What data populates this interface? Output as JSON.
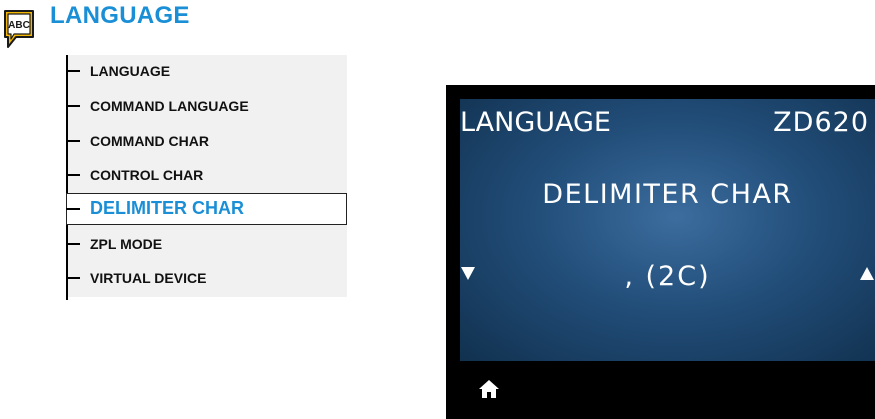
{
  "header": {
    "title": "LANGUAGE",
    "icon": "abc-speech-bubble-icon",
    "icon_text": "ABC",
    "accent_color": "#1a8fd6",
    "icon_color": "#f2b705"
  },
  "menu": {
    "items": [
      {
        "label": "LANGUAGE",
        "selected": false
      },
      {
        "label": "COMMAND LANGUAGE",
        "selected": false
      },
      {
        "label": "COMMAND CHAR",
        "selected": false
      },
      {
        "label": "CONTROL CHAR",
        "selected": false
      },
      {
        "label": "DELIMITER CHAR",
        "selected": true
      },
      {
        "label": "ZPL MODE",
        "selected": false
      },
      {
        "label": "VIRTUAL DEVICE",
        "selected": false
      }
    ]
  },
  "display": {
    "menu_name": "LANGUAGE",
    "model": "ZD620",
    "setting": "DELIMITER CHAR",
    "value": ", (2C)",
    "left_arrow": "down-triangle-icon",
    "right_arrow": "up-triangle-icon",
    "home": "home-icon"
  }
}
